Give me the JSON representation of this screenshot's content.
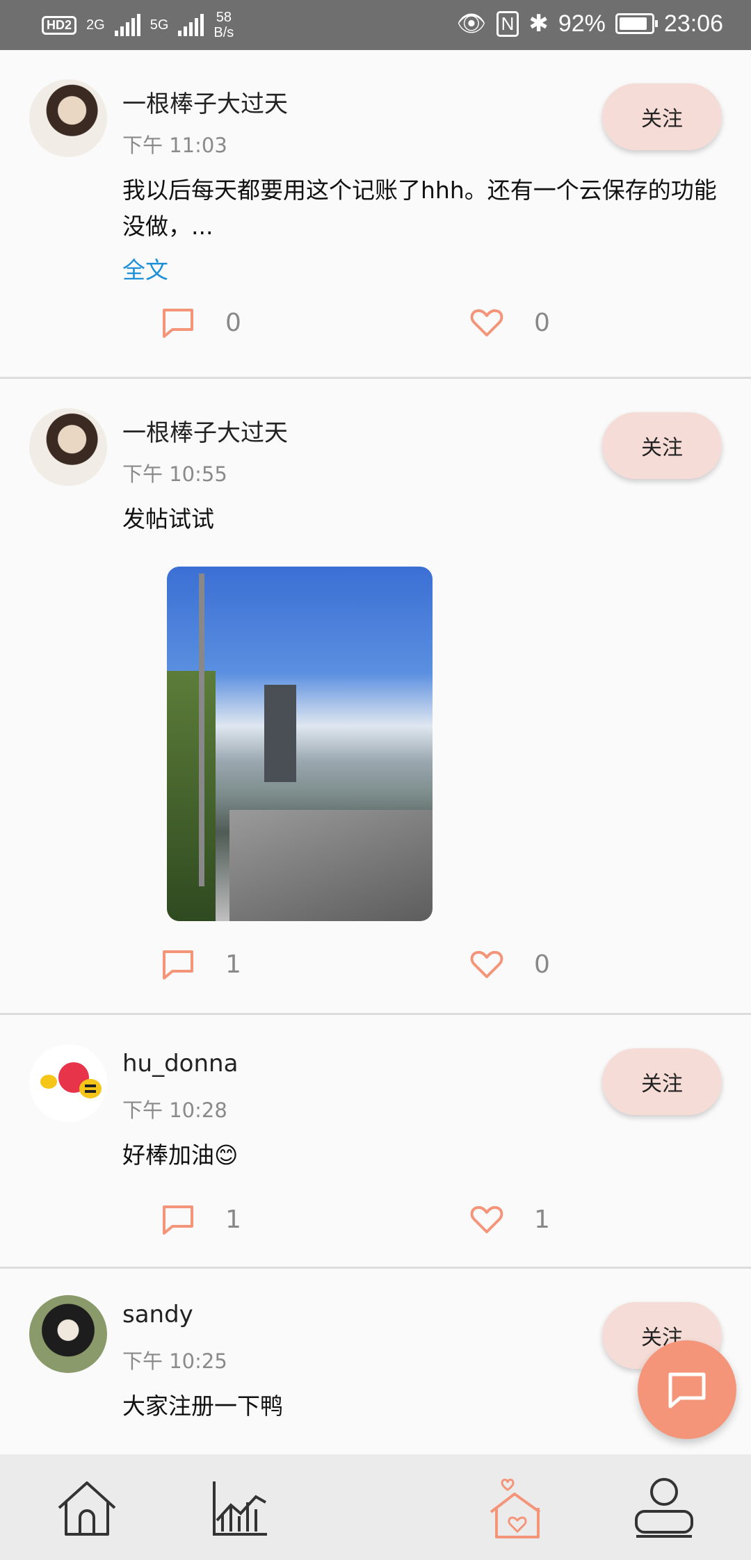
{
  "status": {
    "hd": "HD",
    "sim2": "2",
    "net1": "2G",
    "net2": "5G",
    "speed_value": "58",
    "speed_unit": "B/s",
    "battery": "92%",
    "time": "23:06"
  },
  "colors": {
    "accent": "#f4957a",
    "follow_bg": "#f6dcd6",
    "link": "#1e90d8"
  },
  "posts": [
    {
      "name": "一根棒子大过天",
      "time": "下午 11:03",
      "text": "我以后每天都要用这个记账了hhh。还有一个云保存的功能没做，...",
      "more": "全文",
      "follow": "关注",
      "comments": "0",
      "likes": "0"
    },
    {
      "name": "一根棒子大过天",
      "time": "下午 10:55",
      "text": "发帖试试",
      "follow": "关注",
      "comments": "1",
      "likes": "0"
    },
    {
      "name": "hu_donna",
      "time": "下午 10:28",
      "text": "好棒加油😊",
      "follow": "关注",
      "comments": "1",
      "likes": "1"
    },
    {
      "name": "sandy",
      "time": "下午 10:25",
      "text": "大家注册一下鸭",
      "follow": "关注"
    }
  ],
  "nav": {
    "items": [
      "home-icon",
      "chart-icon",
      "add-icon",
      "community-icon",
      "profile-icon"
    ],
    "plus": "+"
  }
}
